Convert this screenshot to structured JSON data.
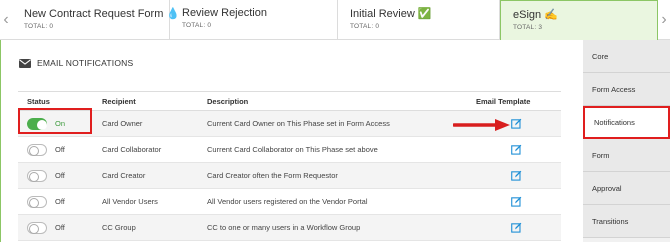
{
  "phases": [
    {
      "name": "New Contract Request Form 💧",
      "total": "TOTAL: 0"
    },
    {
      "name": "Review Rejection",
      "total": "TOTAL: 0"
    },
    {
      "name": "Initial Review ✅",
      "total": "TOTAL: 0"
    },
    {
      "name": "eSign ✍",
      "total": "TOTAL: 3"
    }
  ],
  "section_title": "EMAIL NOTIFICATIONS",
  "table": {
    "headers": {
      "status": "Status",
      "recipient": "Recipient",
      "description": "Description",
      "template": "Email Template"
    },
    "rows": [
      {
        "state": "On",
        "recipient": "Card Owner",
        "description": "Current Card Owner on This Phase set in Form Access"
      },
      {
        "state": "Off",
        "recipient": "Card Collaborator",
        "description": "Current Card Collaborator on This Phase set above"
      },
      {
        "state": "Off",
        "recipient": "Card Creator",
        "description": "Card Creator often the Form Requestor"
      },
      {
        "state": "Off",
        "recipient": "All Vendor Users",
        "description": "All Vendor users registered on the Vendor Portal"
      },
      {
        "state": "Off",
        "recipient": "CC Group",
        "description": "CC to one or many users in a Workflow Group"
      }
    ]
  },
  "side_tabs": [
    "Core",
    "Form Access",
    "Notifications",
    "Form",
    "Approval",
    "Transitions"
  ],
  "colors": {
    "accent_green": "#8cc665",
    "toggle_on": "#4cae4c",
    "highlight_red": "#e01e1e",
    "edit_blue": "#1e8fd6"
  },
  "icons": {
    "section": "envelope-icon",
    "edit": "edit-template-icon",
    "nav": [
      "chevron-left-icon",
      "chevron-right-icon"
    ]
  }
}
